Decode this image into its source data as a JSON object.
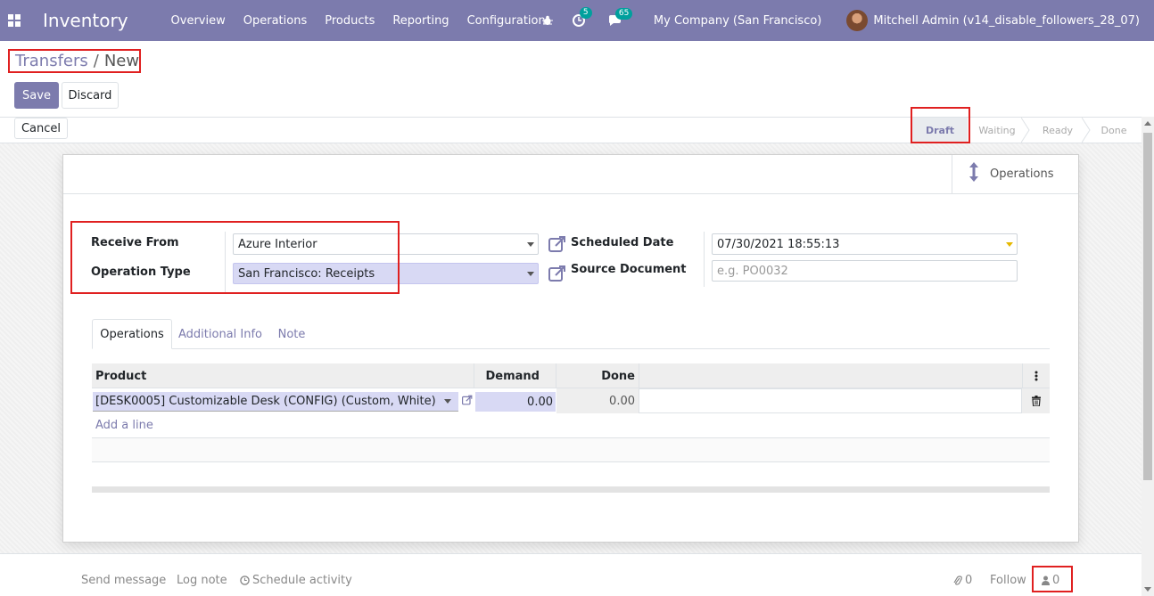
{
  "navbar": {
    "brand": "Inventory",
    "menu": [
      "Overview",
      "Operations",
      "Products",
      "Reporting",
      "Configuration"
    ],
    "activity_count": "5",
    "messages_count": "65",
    "company": "My Company (San Francisco)",
    "user": "Mitchell Admin (v14_disable_followers_28_07)"
  },
  "breadcrumb": {
    "parent": "Transfers",
    "separator": "/",
    "current": "New"
  },
  "buttons": {
    "save": "Save",
    "discard": "Discard",
    "cancel": "Cancel"
  },
  "statusbar": {
    "stages": [
      "Draft",
      "Waiting",
      "Ready",
      "Done"
    ],
    "active_stage": "Draft"
  },
  "smart_button": {
    "label": "Operations"
  },
  "form": {
    "receive_from_label": "Receive From",
    "receive_from_value": "Azure Interior",
    "operation_type_label": "Operation Type",
    "operation_type_value": "San Francisco: Receipts",
    "scheduled_date_label": "Scheduled Date",
    "scheduled_date_value": "07/30/2021 18:55:13",
    "source_document_label": "Source Document",
    "source_document_placeholder": "e.g. PO0032"
  },
  "tabs": [
    "Operations",
    "Additional Info",
    "Note"
  ],
  "table": {
    "headers": {
      "product": "Product",
      "demand": "Demand",
      "done": "Done"
    },
    "rows": [
      {
        "product": "[DESK0005] Customizable Desk (CONFIG) (Custom, White)",
        "demand": "0.00",
        "done": "0.00"
      }
    ],
    "add_line": "Add a line"
  },
  "chatter": {
    "send_message": "Send message",
    "log_note": "Log note",
    "schedule_activity": "Schedule activity",
    "attachments_count": "0",
    "follow": "Follow",
    "followers_count": "0"
  },
  "colors": {
    "brand": "#7c7bad",
    "highlight_box": "#e02020",
    "field_filled": "#d8d9f4",
    "badge": "#00a09d"
  }
}
